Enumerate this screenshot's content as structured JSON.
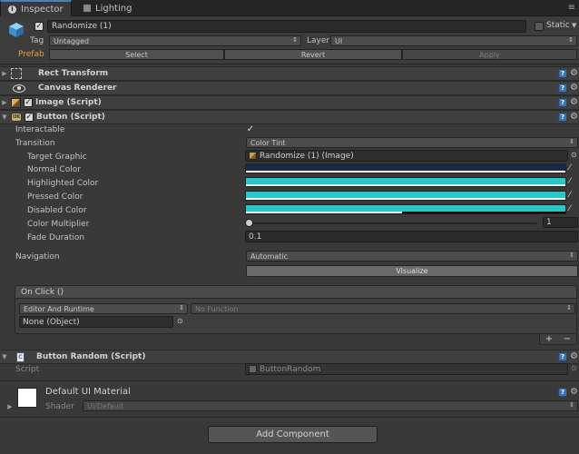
{
  "tabs": [
    {
      "label": "Inspector",
      "icon": "info-icon"
    },
    {
      "label": "Lighting",
      "icon": "lightbulb-icon"
    }
  ],
  "header": {
    "object_name": "Randomize (1)",
    "static_label": "Static",
    "tag_label": "Tag",
    "tag_value": "Untagged",
    "layer_label": "Layer",
    "layer_value": "UI",
    "prefab_label": "Prefab",
    "select_label": "Select",
    "revert_label": "Revert",
    "apply_label": "Apply"
  },
  "components": {
    "rect_transform": "Rect Transform",
    "canvas_renderer": "Canvas Renderer",
    "image": "Image (Script)",
    "button": "Button (Script)"
  },
  "button_props": {
    "interactable_label": "Interactable",
    "transition_label": "Transition",
    "transition_value": "Color Tint",
    "target_graphic_label": "Target Graphic",
    "target_graphic_value": "Randomize (1) (Image)",
    "normal_color_label": "Normal Color",
    "highlighted_color_label": "Highlighted Color",
    "pressed_color_label": "Pressed Color",
    "disabled_color_label": "Disabled Color",
    "color_multiplier_label": "Color Multiplier",
    "color_multiplier_value": "1",
    "color_multiplier_fraction": 0.0,
    "fade_duration_label": "Fade Duration",
    "fade_duration_value": "0.1",
    "navigation_label": "Navigation",
    "navigation_value": "Automatic",
    "visualize_label": "Visualize"
  },
  "colors": {
    "normal": "#1b2a4a",
    "highlighted": "#26c9c9",
    "pressed": "#26c9c9",
    "disabled": "#26c9c9"
  },
  "onclick": {
    "title": "On Click ()",
    "runtime_value": "Editor And Runtime",
    "function_value": "No Function",
    "object_value": "None (Object)",
    "plus": "+",
    "minus": "−"
  },
  "button_random": {
    "title": "Button Random (Script)",
    "script_label": "Script",
    "script_value": "ButtonRandom"
  },
  "material": {
    "title": "Default UI Material",
    "shader_label": "Shader",
    "shader_value": "UI/Default"
  },
  "add_component_label": "Add Component"
}
